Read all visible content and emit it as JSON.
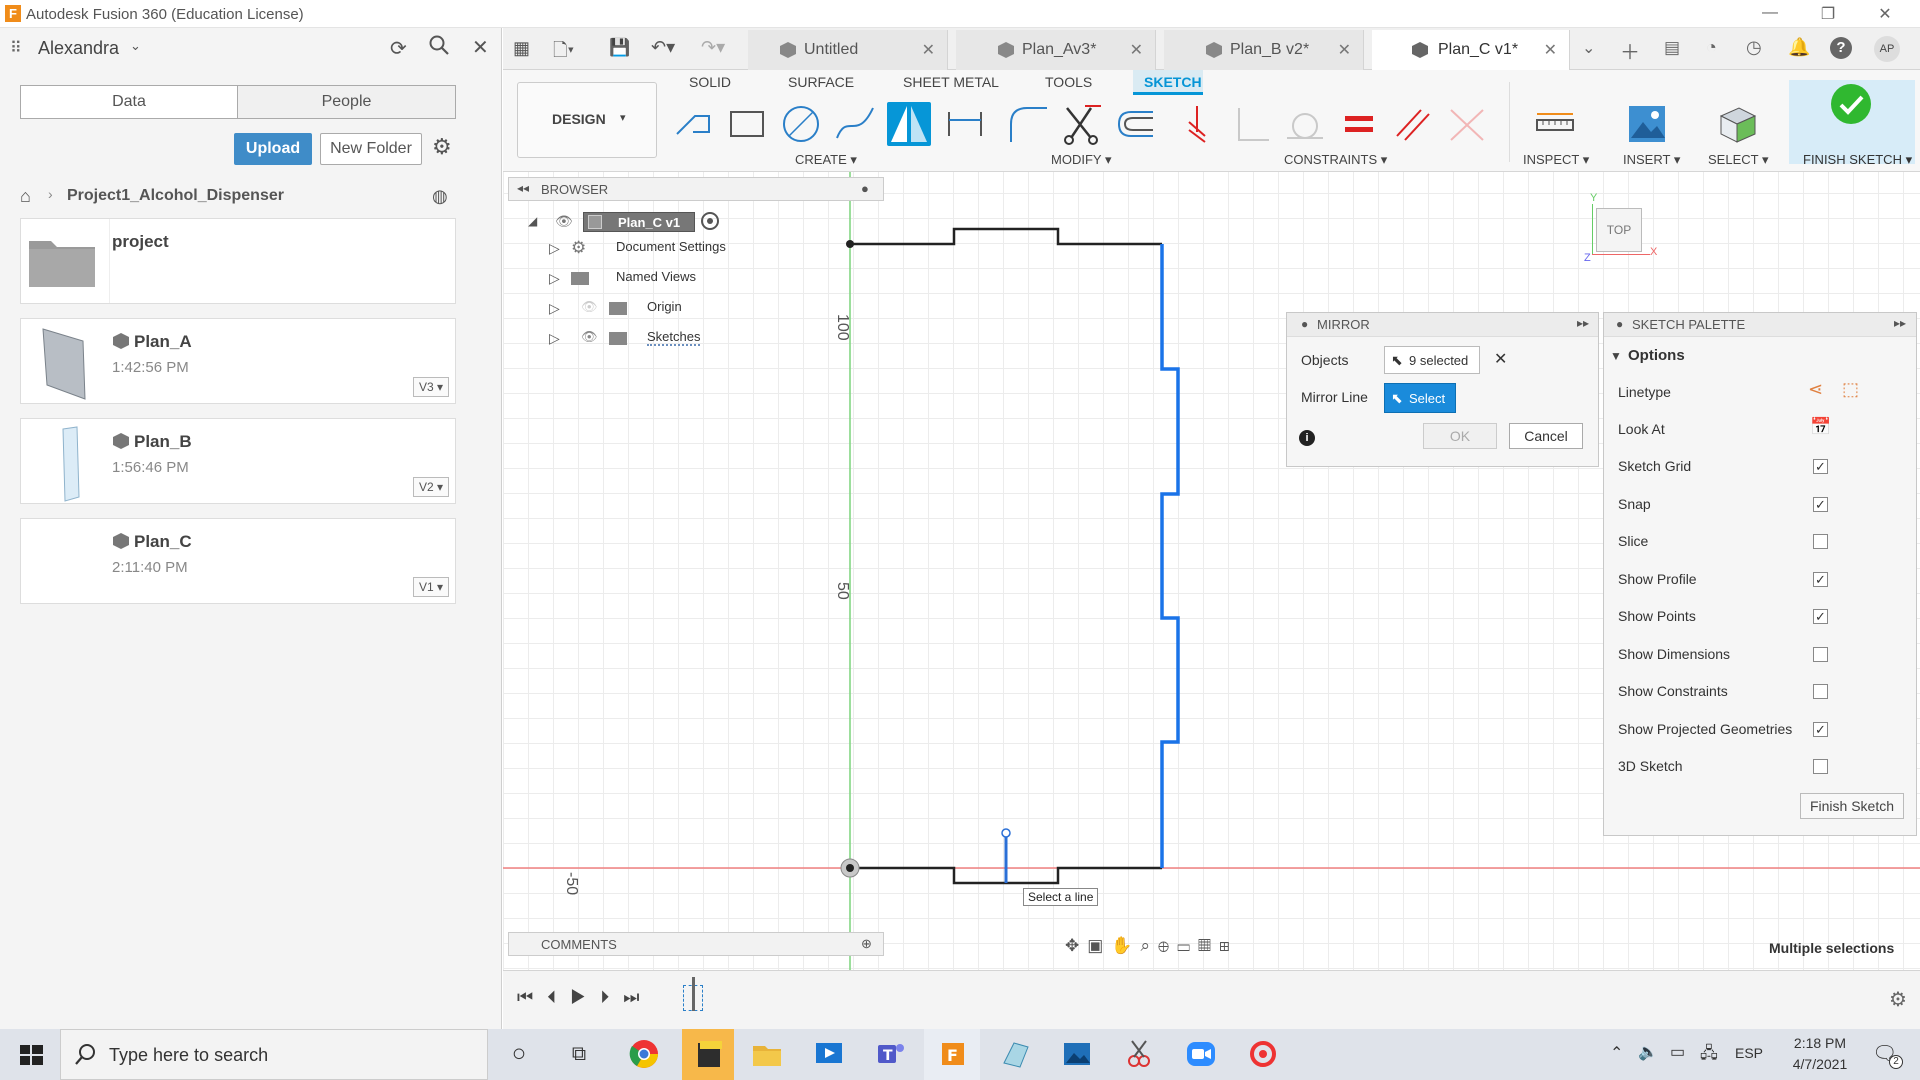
{
  "window": {
    "title": "Autodesk Fusion 360 (Education License)"
  },
  "datapanel": {
    "user": "Alexandra",
    "tabs": [
      "Data",
      "People"
    ],
    "upload_label": "Upload",
    "new_folder_label": "New Folder",
    "breadcrumb": "Project1_Alcohol_Dispenser",
    "items": [
      {
        "name": "project",
        "time": "",
        "version": ""
      },
      {
        "name": "Plan_A",
        "time": "1:42:56 PM",
        "version": "V3"
      },
      {
        "name": "Plan_B",
        "time": "1:56:46 PM",
        "version": "V2"
      },
      {
        "name": "Plan_C",
        "time": "2:11:40 PM",
        "version": "V1"
      }
    ]
  },
  "doc_tabs": [
    {
      "label": "Untitled"
    },
    {
      "label": "Plan_Av3*"
    },
    {
      "label": "Plan_B v2*"
    },
    {
      "label": "Plan_C v1*",
      "active": true
    }
  ],
  "account_initials": "AP",
  "ribbon": {
    "workspace": "DESIGN",
    "tabs": [
      "SOLID",
      "SURFACE",
      "SHEET METAL",
      "TOOLS",
      "SKETCH"
    ],
    "active_tab": "SKETCH",
    "groups": [
      "CREATE",
      "MODIFY",
      "CONSTRAINTS",
      "INSPECT",
      "INSERT",
      "SELECT",
      "FINISH SKETCH"
    ]
  },
  "browser": {
    "title": "BROWSER",
    "root": "Plan_C v1",
    "nodes": [
      "Document Settings",
      "Named Views",
      "Origin",
      "Sketches"
    ]
  },
  "comments": {
    "title": "COMMENTS"
  },
  "viewcube": {
    "face": "TOP",
    "axis_y": "Y",
    "axis_x": "X",
    "axis_z": "Z"
  },
  "ruler": {
    "labels": [
      "100",
      "50",
      "-50"
    ]
  },
  "tooltip": "Select a line",
  "status": "Multiple selections",
  "mirror": {
    "title": "MIRROR",
    "objects_label": "Objects",
    "objects_value": "9 selected",
    "mirror_line_label": "Mirror Line",
    "mirror_line_value": "Select",
    "ok": "OK",
    "cancel": "Cancel"
  },
  "palette": {
    "title": "SKETCH PALETTE",
    "section": "Options",
    "linetype": "Linetype",
    "look_at": "Look At",
    "options": [
      {
        "label": "Sketch Grid",
        "checked": true
      },
      {
        "label": "Snap",
        "checked": true
      },
      {
        "label": "Slice",
        "checked": false
      },
      {
        "label": "Show Profile",
        "checked": true
      },
      {
        "label": "Show Points",
        "checked": true
      },
      {
        "label": "Show Dimensions",
        "checked": false
      },
      {
        "label": "Show Constraints",
        "checked": false
      },
      {
        "label": "Show Projected Geometries",
        "checked": true
      },
      {
        "label": "3D Sketch",
        "checked": false
      }
    ],
    "finish_label": "Finish Sketch"
  },
  "taskbar": {
    "search_placeholder": "Type here to search",
    "language": "ESP",
    "time": "2:18 PM",
    "date": "4/7/2021",
    "notification_count": "2"
  },
  "colors": {
    "accent": "#0696d7",
    "sketch_tab": "#0696d7",
    "finish_green": "#30b830",
    "selected_blue": "#1a73e8"
  }
}
